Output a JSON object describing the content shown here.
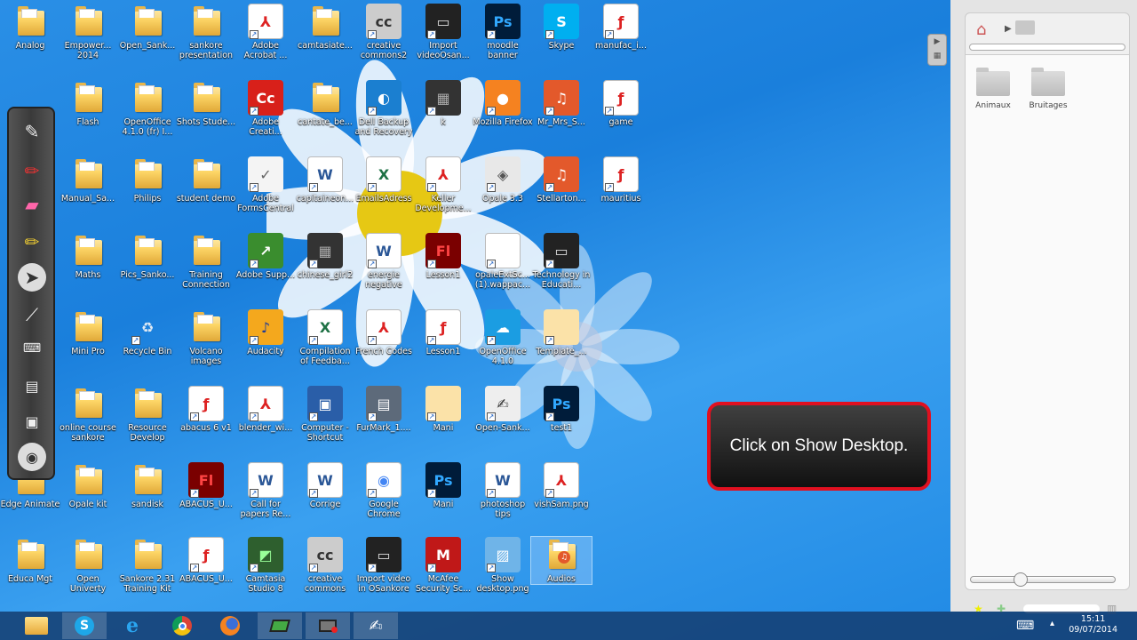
{
  "desktop": {
    "icons": [
      {
        "label": "Analog",
        "type": "folder",
        "col": 0,
        "row": 0
      },
      {
        "label": "Empower... 2014",
        "type": "folder",
        "col": 1,
        "row": 0
      },
      {
        "label": "Open_Sank...",
        "type": "folder",
        "col": 2,
        "row": 0
      },
      {
        "label": "sankore presentation",
        "type": "folder",
        "col": 3,
        "row": 0
      },
      {
        "label": "Adobe Acrobat ...",
        "type": "pdf",
        "col": 4,
        "row": 0
      },
      {
        "label": "camtasiate...",
        "type": "folder",
        "col": 5,
        "row": 0
      },
      {
        "label": "creative commons2",
        "type": "cc",
        "col": 6,
        "row": 0
      },
      {
        "label": "Import videoOsan...",
        "type": "video",
        "col": 7,
        "row": 0
      },
      {
        "label": "moodle banner",
        "type": "psd",
        "col": 8,
        "row": 0
      },
      {
        "label": "Skype",
        "type": "skype",
        "col": 9,
        "row": 0
      },
      {
        "label": "manufac_i...",
        "type": "swf",
        "col": 10,
        "row": 0
      },
      {
        "label": "Flash",
        "type": "folder",
        "col": 1,
        "row": 1
      },
      {
        "label": "OpenOffice 4.1.0 (fr) I...",
        "type": "folder",
        "col": 2,
        "row": 1
      },
      {
        "label": "Shots Stude...",
        "type": "folder",
        "col": 3,
        "row": 1
      },
      {
        "label": "Adobe Creati...",
        "type": "adobecc",
        "col": 4,
        "row": 1
      },
      {
        "label": "cantate_be...",
        "type": "folder",
        "col": 5,
        "row": 1
      },
      {
        "label": "Dell Backup and Recovery",
        "type": "dell",
        "col": 6,
        "row": 1
      },
      {
        "label": "k",
        "type": "photo",
        "col": 7,
        "row": 1
      },
      {
        "label": "Mozilla Firefox",
        "type": "firefox",
        "col": 8,
        "row": 1
      },
      {
        "label": "Mr_Mrs_S...",
        "type": "audio",
        "col": 9,
        "row": 1
      },
      {
        "label": "game",
        "type": "swf",
        "col": 10,
        "row": 1
      },
      {
        "label": "Manual_Sa...",
        "type": "folder",
        "col": 1,
        "row": 2
      },
      {
        "label": "Philips",
        "type": "folder",
        "col": 2,
        "row": 2
      },
      {
        "label": "student demo",
        "type": "folder",
        "col": 3,
        "row": 2
      },
      {
        "label": "Adobe FormsCentral",
        "type": "forms",
        "col": 4,
        "row": 2
      },
      {
        "label": "capitaineon...",
        "type": "word",
        "col": 5,
        "row": 2
      },
      {
        "label": "EmailsAdress",
        "type": "excel",
        "col": 6,
        "row": 2
      },
      {
        "label": "Keller Developme...",
        "type": "pdf",
        "col": 7,
        "row": 2
      },
      {
        "label": "Opale 3.3",
        "type": "opale",
        "col": 8,
        "row": 2
      },
      {
        "label": "Stellarton...",
        "type": "audio",
        "col": 9,
        "row": 2
      },
      {
        "label": "mauritius",
        "type": "swf",
        "col": 10,
        "row": 2
      },
      {
        "label": "Maths",
        "type": "folder",
        "col": 1,
        "row": 3
      },
      {
        "label": "Pics_Sanko...",
        "type": "folder",
        "col": 2,
        "row": 3
      },
      {
        "label": "Training Connection",
        "type": "folder",
        "col": 3,
        "row": 3
      },
      {
        "label": "Adobe Supp...",
        "type": "adobesupport",
        "col": 4,
        "row": 3
      },
      {
        "label": "chinese_girl2",
        "type": "photo",
        "col": 5,
        "row": 3
      },
      {
        "label": "energie negative",
        "type": "word",
        "col": 6,
        "row": 3
      },
      {
        "label": "Lesson1",
        "type": "fla",
        "col": 7,
        "row": 3
      },
      {
        "label": "opaleExtSc... (1).wappac...",
        "type": "blank",
        "col": 8,
        "row": 3
      },
      {
        "label": "Technology in Educati...",
        "type": "video",
        "col": 9,
        "row": 3
      },
      {
        "label": "Mini Pro",
        "type": "folder",
        "col": 1,
        "row": 4
      },
      {
        "label": "Recycle Bin",
        "type": "recycle",
        "col": 2,
        "row": 4
      },
      {
        "label": "Volcano images",
        "type": "folder",
        "col": 3,
        "row": 4
      },
      {
        "label": "Audacity",
        "type": "audacity",
        "col": 4,
        "row": 4
      },
      {
        "label": "Compilation of Feedba...",
        "type": "excel",
        "col": 5,
        "row": 4
      },
      {
        "label": "French Codes",
        "type": "pdf",
        "col": 6,
        "row": 4
      },
      {
        "label": "Lesson1",
        "type": "swf",
        "col": 7,
        "row": 4
      },
      {
        "label": "OpenOffice 4.1.0",
        "type": "openoffice",
        "col": 8,
        "row": 4
      },
      {
        "label": "Template_...",
        "type": "folderplain",
        "col": 9,
        "row": 4
      },
      {
        "label": "online course sankore",
        "type": "folder",
        "col": 1,
        "row": 5
      },
      {
        "label": "Resource Develop",
        "type": "folder",
        "col": 2,
        "row": 5
      },
      {
        "label": "abacus 6 v1",
        "type": "swf",
        "col": 3,
        "row": 5
      },
      {
        "label": "blender_wi...",
        "type": "pdf",
        "col": 4,
        "row": 5
      },
      {
        "label": "Computer - Shortcut",
        "type": "computer",
        "col": 5,
        "row": 5
      },
      {
        "label": "FurMark_1....",
        "type": "furmark",
        "col": 6,
        "row": 5
      },
      {
        "label": "Mani",
        "type": "folderplain",
        "col": 7,
        "row": 5
      },
      {
        "label": "Open-Sank...",
        "type": "sankore",
        "col": 8,
        "row": 5
      },
      {
        "label": "test1",
        "type": "psd",
        "col": 9,
        "row": 5
      },
      {
        "label": "Edge Animate",
        "type": "folder",
        "col": 0,
        "row": 6
      },
      {
        "label": "Opale kit",
        "type": "folder",
        "col": 1,
        "row": 6
      },
      {
        "label": "sandisk",
        "type": "folder",
        "col": 2,
        "row": 6
      },
      {
        "label": "ABACUS_U...",
        "type": "fla",
        "col": 3,
        "row": 6
      },
      {
        "label": "Call for papers Re...",
        "type": "word",
        "col": 4,
        "row": 6
      },
      {
        "label": "Corrige",
        "type": "word",
        "col": 5,
        "row": 6
      },
      {
        "label": "Google Chrome",
        "type": "chrome",
        "col": 6,
        "row": 6
      },
      {
        "label": "Mani",
        "type": "psd",
        "col": 7,
        "row": 6
      },
      {
        "label": "photoshop tips",
        "type": "word",
        "col": 8,
        "row": 6
      },
      {
        "label": "vishSam.png",
        "type": "pdf",
        "col": 9,
        "row": 6
      },
      {
        "label": "Educa Mgt",
        "type": "folder",
        "col": 0,
        "row": 7
      },
      {
        "label": "Open Univerty",
        "type": "folder",
        "col": 1,
        "row": 7
      },
      {
        "label": "Sankore 2.31 Training Kit",
        "type": "folder",
        "col": 2,
        "row": 7
      },
      {
        "label": "ABACUS_U...",
        "type": "swf",
        "col": 3,
        "row": 7
      },
      {
        "label": "Camtasia Studio 8",
        "type": "camtasia",
        "col": 4,
        "row": 7
      },
      {
        "label": "creative commons",
        "type": "cc",
        "col": 5,
        "row": 7
      },
      {
        "label": "Import video in OSankore",
        "type": "video",
        "col": 6,
        "row": 7
      },
      {
        "label": "McAfee Security Sc...",
        "type": "mcafee",
        "col": 7,
        "row": 7
      },
      {
        "label": "Show desktop.png",
        "type": "image",
        "col": 8,
        "row": 7
      },
      {
        "label": "Audios",
        "type": "audiofolder",
        "col": 9,
        "row": 7,
        "selected": true
      }
    ]
  },
  "toolbar": {
    "tools": [
      "pen-tool-icon",
      "marker-icon",
      "eraser-icon",
      "highlighter-icon",
      "pointer-icon",
      "laser-icon",
      "keyboard-icon",
      "display-icon",
      "capture-icon",
      "hide-icon"
    ]
  },
  "panel": {
    "folders": [
      {
        "label": "Animaux"
      },
      {
        "label": "Bruitages"
      }
    ],
    "slider_value": 0.3
  },
  "callout": {
    "text": "Click on Show Desktop."
  },
  "taskbar": {
    "apps": [
      "explorer",
      "skype",
      "ie",
      "chrome",
      "firefox",
      "camtasia",
      "sankore-recorder",
      "sankore"
    ],
    "time": "15:11",
    "date": "09/07/2014"
  },
  "colors": {
    "desktop_bg": "#1f87e2",
    "callout_border": "#e01020",
    "taskbar_bg": "#143c6e"
  }
}
